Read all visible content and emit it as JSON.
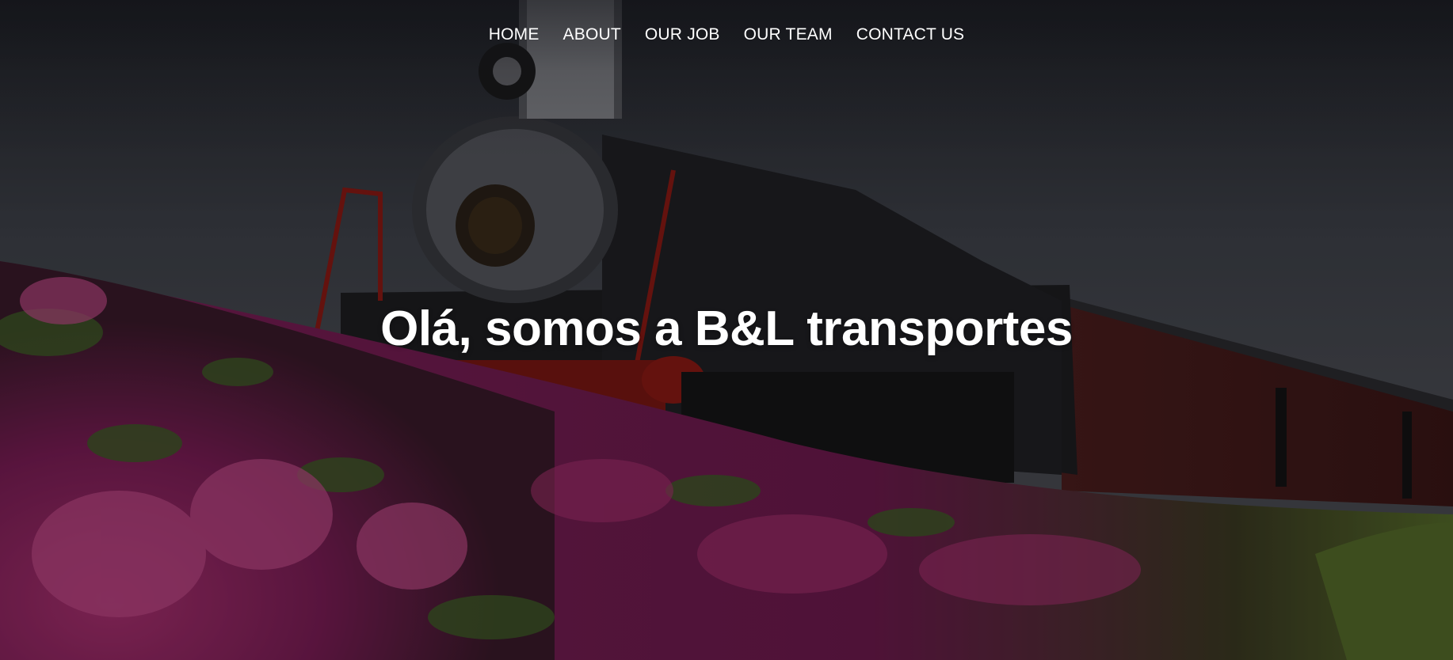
{
  "nav": {
    "items": [
      {
        "label": "HOME"
      },
      {
        "label": "ABOUT"
      },
      {
        "label": "OUR JOB"
      },
      {
        "label": "OUR TEAM"
      },
      {
        "label": "CONTACT US"
      }
    ]
  },
  "hero": {
    "headline": "Olá, somos a B&L transportes"
  },
  "colors": {
    "text": "#ffffff",
    "sky": "#40434b",
    "flowers": "#8a1e63",
    "foliage": "#3f5a28",
    "locomotive": "#1b1b1d",
    "locomotive_red": "#8b1a14"
  },
  "background_image": "steam-locomotive-with-pink-azaleas"
}
